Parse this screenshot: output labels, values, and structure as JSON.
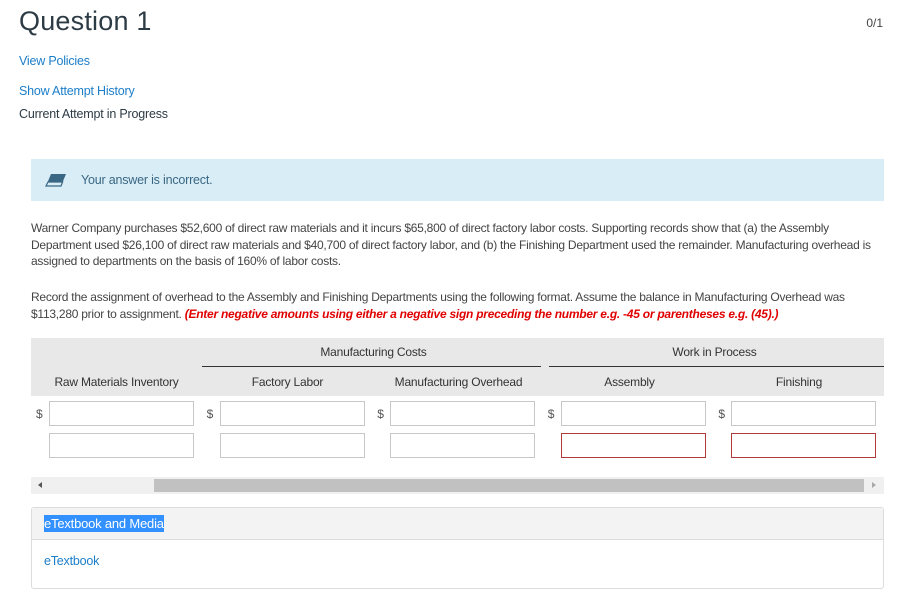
{
  "header": {
    "title": "Question 1",
    "score": "0/1",
    "view_policies": "View Policies",
    "show_attempt_history": "Show Attempt History",
    "current_attempt": "Current Attempt in Progress"
  },
  "feedback": {
    "icon": "eraser-icon",
    "text": "Your answer is incorrect.",
    "color": "#d9edf7"
  },
  "problem": {
    "paragraph1": "Warner Company purchases $52,600 of direct raw materials and it incurs $65,800 of direct factory labor costs. Supporting records show that (a) the Assembly Department used $26,100 of direct raw materials and $40,700 of direct factory labor, and (b) the Finishing Department used the remainder. Manufacturing overhead is assigned to departments on the basis of 160% of labor costs.",
    "paragraph2": "Record the assignment of overhead to the Assembly and Finishing Departments using the following format. Assume the balance in Manufacturing Overhead was $113,280 prior to assignment.",
    "instruction": "(Enter negative amounts using either a negative sign preceding the number e.g. -45 or parentheses e.g. (45).)",
    "instruction_color": "#e00000"
  },
  "table": {
    "group_headers": {
      "manufacturing_costs": "Manufacturing Costs",
      "work_in_process": "Work in Process"
    },
    "columns": [
      "Raw Materials Inventory",
      "Factory Labor",
      "Manufacturing Overhead",
      "Assembly",
      "Finishing"
    ],
    "currency_symbol": "$",
    "rows": [
      {
        "values": [
          "",
          "",
          "",
          "",
          ""
        ],
        "errors": [
          false,
          false,
          false,
          false,
          false
        ]
      },
      {
        "values": [
          "",
          "",
          "",
          "",
          ""
        ],
        "errors": [
          false,
          false,
          false,
          true,
          true
        ]
      }
    ]
  },
  "etextbook": {
    "header": "eTextbook and Media",
    "link": "eTextbook"
  }
}
